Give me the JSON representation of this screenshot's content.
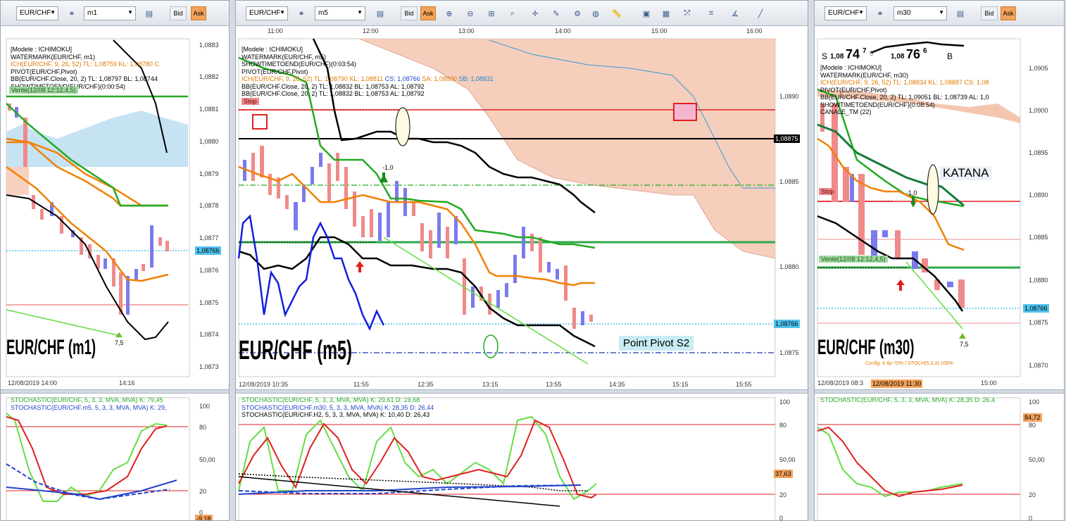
{
  "panels": {
    "left": {
      "symbol": "EUR/CHF",
      "timeframe": "m1",
      "bid_label": "Bid",
      "ask_label": "Ask",
      "legend": [
        "[Modele : ICHIMOKU]",
        "WATERMARK(EUR/CHF, m1)",
        "ICH(EUR/CHF, 9, 26, 52)  TL: 1,08759  KL: 1,08780  C",
        "PIVOT(EUR/CHF,Pivot)",
        "BB(EUR/CHF.Close, 20, 2)  TL: 1,08797  BL: 1,08744",
        "SHOWTIMETOEND(EUR/CHF)(0:00:54)"
      ],
      "y_ticks": [
        "1,0883",
        "1,0882",
        "1,0881",
        "1,0880",
        "1,0879",
        "1,0878",
        "1,0877",
        "1,0876",
        "1,0875",
        "1,0874",
        "1,0873"
      ],
      "x_ticks": [
        "12/08/2019 14:00",
        "14:16"
      ],
      "price_tag": "1,08766",
      "sell_label": "Vente(12/08 12:12,4,5)",
      "arrow_value": "7,5",
      "watermark": "EUR/CHF (m1)",
      "stoch_legend": [
        "STOCHASTIC(EUR/CHF, 5, 3, 3, MVA, MVA)  K: 79,45",
        "STOCHASTIC(EUR/CHF.m5, 5, 3, 3, MVA, MVA)  K: 29,"
      ],
      "stoch_ticks": [
        "100",
        "80",
        "50,00",
        "20",
        "0"
      ],
      "stoch_tag": "-9,18"
    },
    "middle": {
      "symbol": "EUR/CHF",
      "timeframe": "m5",
      "bid_label": "Bid",
      "ask_label": "Ask",
      "time_ticks_top": [
        "11:00",
        "12:00",
        "13:00",
        "14:00",
        "15:00",
        "16:00"
      ],
      "legend": [
        "[Modele : ICHIMOKU]",
        "WATERMARK(EUR/CHF, m5)",
        "SHOWTIMETOEND(EUR/CHF)(0:03:54)",
        "PIVOT(EUR/CHF,Pivot)"
      ],
      "legend_ich": [
        "ICH(EUR/CHF, 9, 26, 52)  TL: 1,08790  KL: 1,08811  ",
        "CS: 1,08766  ",
        "SA: 1,08800  ",
        "SB: 1,08831"
      ],
      "legend_bb": [
        "BB(EUR/CHF.Close, 20, 2)  TL: 1,08832  BL: 1,08753  AL: 1,08792",
        "BB(EUR/CHF.Close, 20, 2)  TL: 1,08832  BL: 1,08753  AL: 1,08792"
      ],
      "y_ticks": [
        "1,0890",
        "1,0885",
        "1,0880",
        "1,0875"
      ],
      "price_tag_black": "1,08875",
      "price_tag_blue": "1,08766",
      "x_ticks": [
        "12/08/2019 10:35",
        "11:55",
        "12:35",
        "13:15",
        "13:55",
        "14:35",
        "15:15",
        "15:55"
      ],
      "stop_label": "Stop",
      "arrow_value": "-1,0",
      "watermark": "EUR/CHF (m5)",
      "pivot_label": "Point Pivot S2",
      "stoch_legend": [
        "STOCHASTIC(EUR/CHF, 5, 3, 3, MVA, MVA)  K: 29,61  D: 19,68",
        "STOCHASTIC(EUR/CHF.m30, 5, 3, 3, MVA, MVA)  K: 28,35  D: 26,44",
        "STOCHASTIC(EUR/CHF.H2, 5, 3, 3, MVA, MVA)  K: 10,40  D: 26,43"
      ],
      "stoch_ticks": [
        "100",
        "80",
        "50,00",
        "20",
        "0"
      ],
      "stoch_tag": "37,63"
    },
    "right": {
      "symbol": "EUR/CHF",
      "timeframe": "m30",
      "bid_label": "Bid",
      "ask_label": "Ask",
      "quote_sell_prefix": "S",
      "quote_sell_big": "1,08",
      "quote_sell_pips": "74",
      "quote_sell_frac": "7",
      "quote_sell_extra": "5",
      "quote_buy_big": "1,08",
      "quote_buy_pips": "76",
      "quote_buy_frac": "6",
      "quote_buy_suffix": "B",
      "legend": [
        "[Modele : ICHIMOKU]",
        "WATERMARK(EUR/CHF, m30)",
        "ICH(EUR/CHF, 9, 26, 52)  TL: 1,08834  KL: 1,08887  CS: 1,08",
        "PIVOT(EUR/CHF,Pivot)",
        "BB(EUR/CHF.Close, 20, 2)  TL: 1,09051  BL: 1,08739  AL: 1,0",
        "SHOWTIMETOEND(EUR/CHF)(0:08:54)",
        "CANALE_TM (22)"
      ],
      "y_ticks": [
        "1,0905",
        "1,0900",
        "1,0895",
        "1,0890",
        "1,0885",
        "1,0880",
        "1,0875",
        "1,0870"
      ],
      "x_ticks": [
        "12/08/2019 08:3",
        "12/08/2019 11:30",
        "15:00"
      ],
      "price_tag": "1,08766",
      "katana_label": "KATANA",
      "stop_label": "Stop",
      "sell_label": "Vente(12/08 12:12,4,5)",
      "arrow_value_top": "-1,0",
      "arrow_value": "7,5",
      "watermark": "EUR/CHF (m30)",
      "config_text": "Config: 6.4p-70% / STOCH(5,3,3)-100%",
      "stoch_legend": [
        "STOCHASTIC(EUR/CHF, 5, 3, 3, MVA, MVA)  K: 28,35  D: 26,4"
      ],
      "stoch_ticks": [
        "100",
        "80",
        "50,00",
        "20",
        "0"
      ],
      "stoch_tag": "84,72"
    }
  },
  "colors": {
    "bull_candle": "#7a7aee",
    "bear_candle": "#f08a8a",
    "kumo": "#f4c6b0",
    "kumo_blue": "#b8dcf0",
    "stop_red": "#e02020",
    "pivot_green": "#2ea84a",
    "kijun_orange": "#f08000",
    "tenkan_green": "#22aa22",
    "price_blue": "#4ec3ef"
  }
}
